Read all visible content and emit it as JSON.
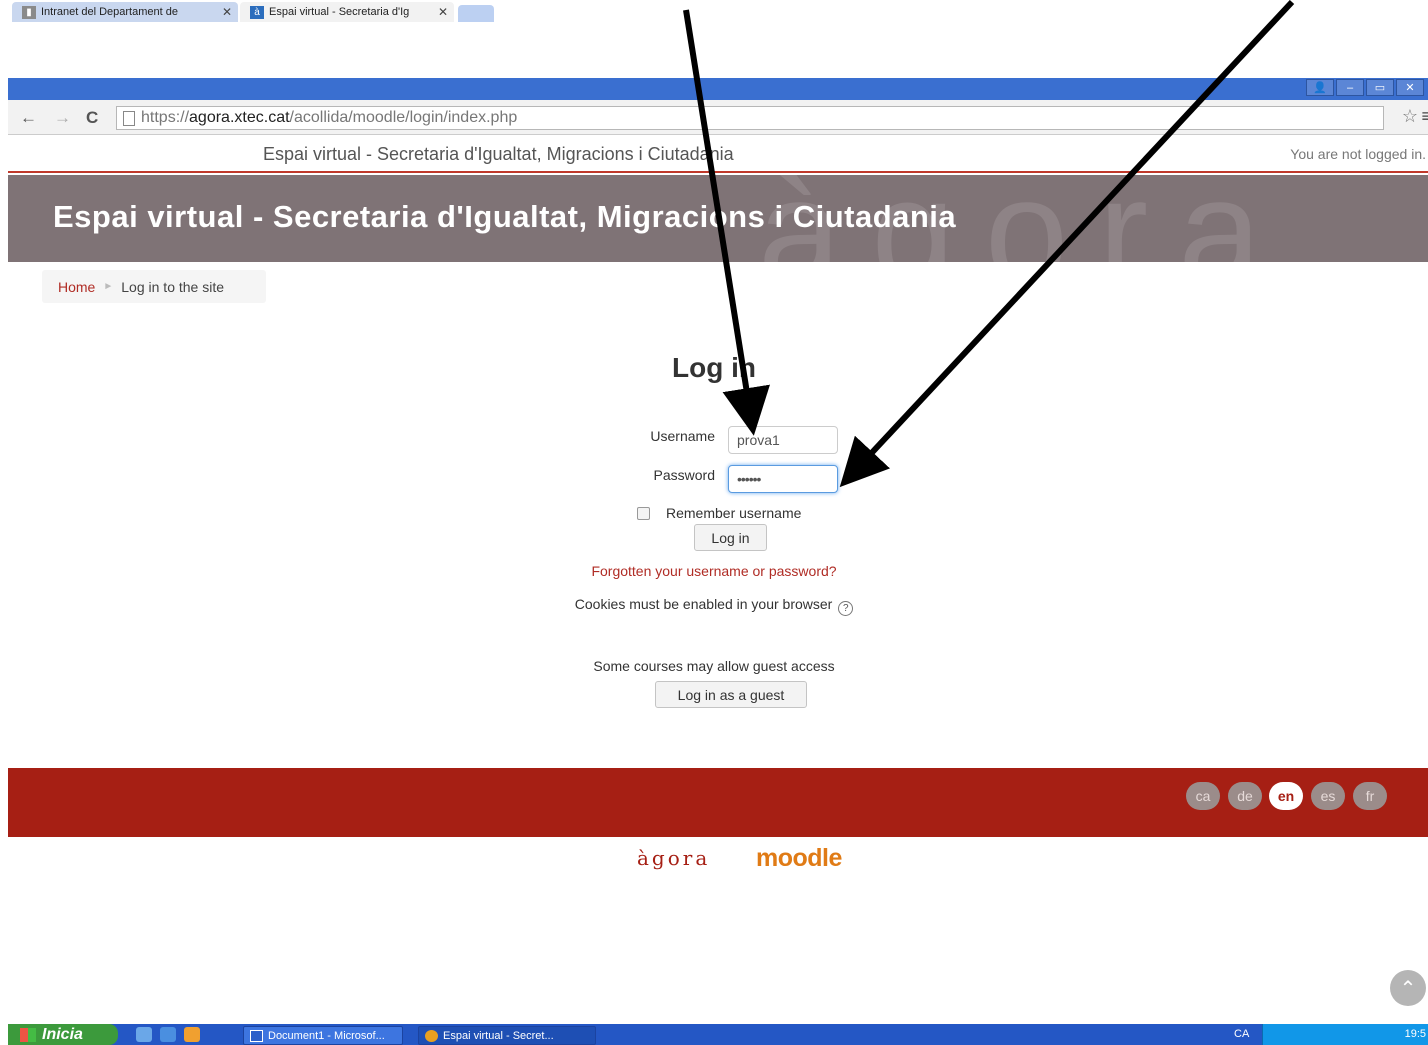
{
  "browser": {
    "tabs": [
      {
        "title": "Intranet del Departament de",
        "active": false
      },
      {
        "title": "Espai virtual - Secretaria d'Ig",
        "active": true
      }
    ],
    "url_scheme": "https://",
    "url_host": "agora.xtec.cat",
    "url_path": "/acollida/moodle/login/index.php"
  },
  "top_bar": {
    "site_name": "Espai virtual - Secretaria d'Igualtat, Migracions i Ciutadania",
    "login_info": "You are not logged in."
  },
  "header": {
    "title": "Espai virtual - Secretaria d'Igualtat, Migracions i Ciutadania"
  },
  "breadcrumb": {
    "home": "Home",
    "current": "Log in to the site"
  },
  "login": {
    "heading": "Log in",
    "username_label": "Username",
    "username_value": "prova1",
    "password_label": "Password",
    "password_value": "••••••",
    "remember_label": "Remember username",
    "remember_checked": false,
    "login_button": "Log in",
    "forgot_link": "Forgotten your username or password?",
    "cookies_text": "Cookies must be enabled in your browser",
    "guest_text": "Some courses may allow guest access",
    "guest_button": "Log in as a guest"
  },
  "footer": {
    "languages": [
      "ca",
      "de",
      "en",
      "es",
      "fr"
    ],
    "active_language": "en",
    "logo_agora": "àgora",
    "logo_moodle": "moodle"
  },
  "taskbar": {
    "start_label": "Inicia",
    "items": [
      {
        "label": "Document1 - Microsof..."
      },
      {
        "label": "Espai virtual - Secret..."
      }
    ],
    "language_indicator": "CA",
    "clock": "19:5"
  },
  "colors": {
    "brand_red": "#a61f14",
    "header_gray": "#7f7376",
    "link_red": "#b02c25"
  }
}
